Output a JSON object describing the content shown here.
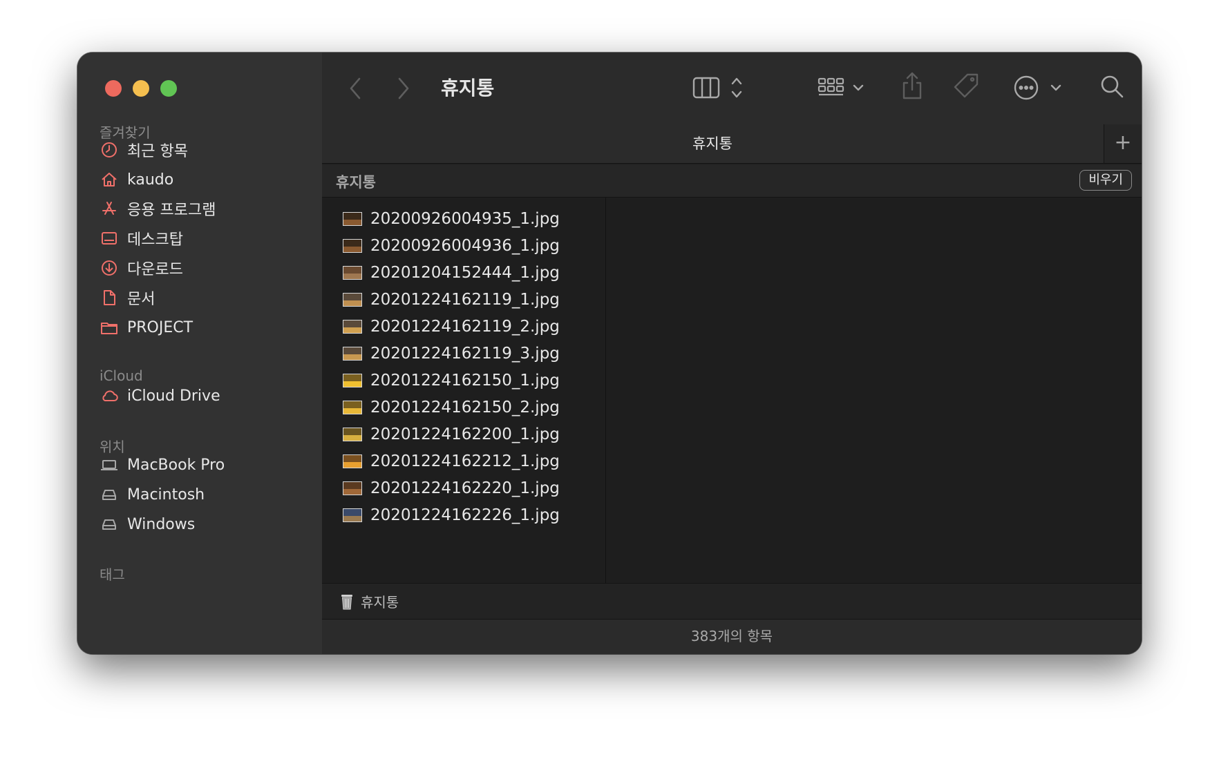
{
  "sidebar": {
    "sections": {
      "favorites": "즐겨찾기",
      "icloud": "iCloud",
      "locations": "위치",
      "tags": "태그"
    },
    "favorites": [
      {
        "label": "최근 항목",
        "icon": "clock-icon"
      },
      {
        "label": "kaudo",
        "icon": "home-icon"
      },
      {
        "label": "응용 프로그램",
        "icon": "apps-icon"
      },
      {
        "label": "데스크탑",
        "icon": "desktop-icon"
      },
      {
        "label": "다운로드",
        "icon": "download-icon"
      },
      {
        "label": "문서",
        "icon": "document-icon"
      },
      {
        "label": "PROJECT",
        "icon": "folder-icon"
      }
    ],
    "icloud_items": [
      {
        "label": "iCloud Drive",
        "icon": "cloud-icon"
      }
    ],
    "locations": [
      {
        "label": "MacBook Pro",
        "icon": "laptop-icon"
      },
      {
        "label": "Macintosh",
        "icon": "drive-icon"
      },
      {
        "label": "Windows",
        "icon": "drive-icon"
      }
    ]
  },
  "toolbar": {
    "title": "휴지통"
  },
  "tabs": [
    {
      "label": "휴지통"
    }
  ],
  "tab_add": "+",
  "pathbar": {
    "title": "휴지통",
    "empty_button": "비우기"
  },
  "files": [
    {
      "name": "20200926004935_1.jpg"
    },
    {
      "name": "20200926004936_1.jpg"
    },
    {
      "name": "20201204152444_1.jpg"
    },
    {
      "name": "20201224162119_1.jpg"
    },
    {
      "name": "20201224162119_2.jpg"
    },
    {
      "name": "20201224162119_3.jpg"
    },
    {
      "name": "20201224162150_1.jpg"
    },
    {
      "name": "20201224162150_2.jpg"
    },
    {
      "name": "20201224162200_1.jpg"
    },
    {
      "name": "20201224162212_1.jpg"
    },
    {
      "name": "20201224162220_1.jpg"
    },
    {
      "name": "20201224162226_1.jpg"
    }
  ],
  "location_bar": {
    "label": "휴지통",
    "icon": "trash-icon"
  },
  "status": "383개의 항목",
  "colors": {
    "accent": "#f0706a",
    "window_bg": "#1e1e1e",
    "sidebar_bg": "#323232"
  }
}
